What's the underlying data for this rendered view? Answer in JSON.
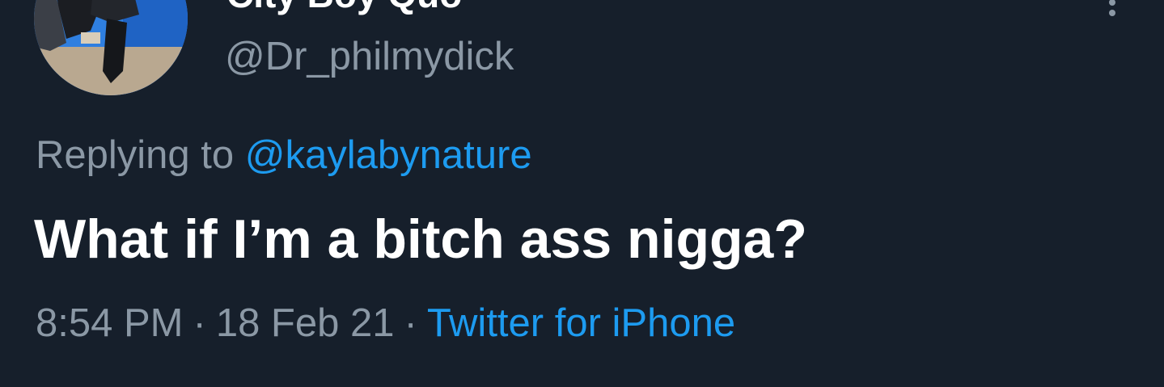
{
  "tweet": {
    "display_name": "City Boy Quo",
    "handle": "@Dr_philmydick",
    "replying_prefix": "Replying to",
    "replying_to": "@kaylabynature",
    "text": "What if I’m a bitch ass nigga?",
    "time": "8:54 PM",
    "separator": "·",
    "date": "18 Feb 21",
    "source": "Twitter for iPhone"
  },
  "icons": {
    "more": "more-options-icon",
    "avatar": "profile-avatar"
  },
  "colors": {
    "background": "#161f2b",
    "primary_text": "#ffffff",
    "secondary_text": "#8b98a5",
    "accent": "#1d9bf0"
  }
}
